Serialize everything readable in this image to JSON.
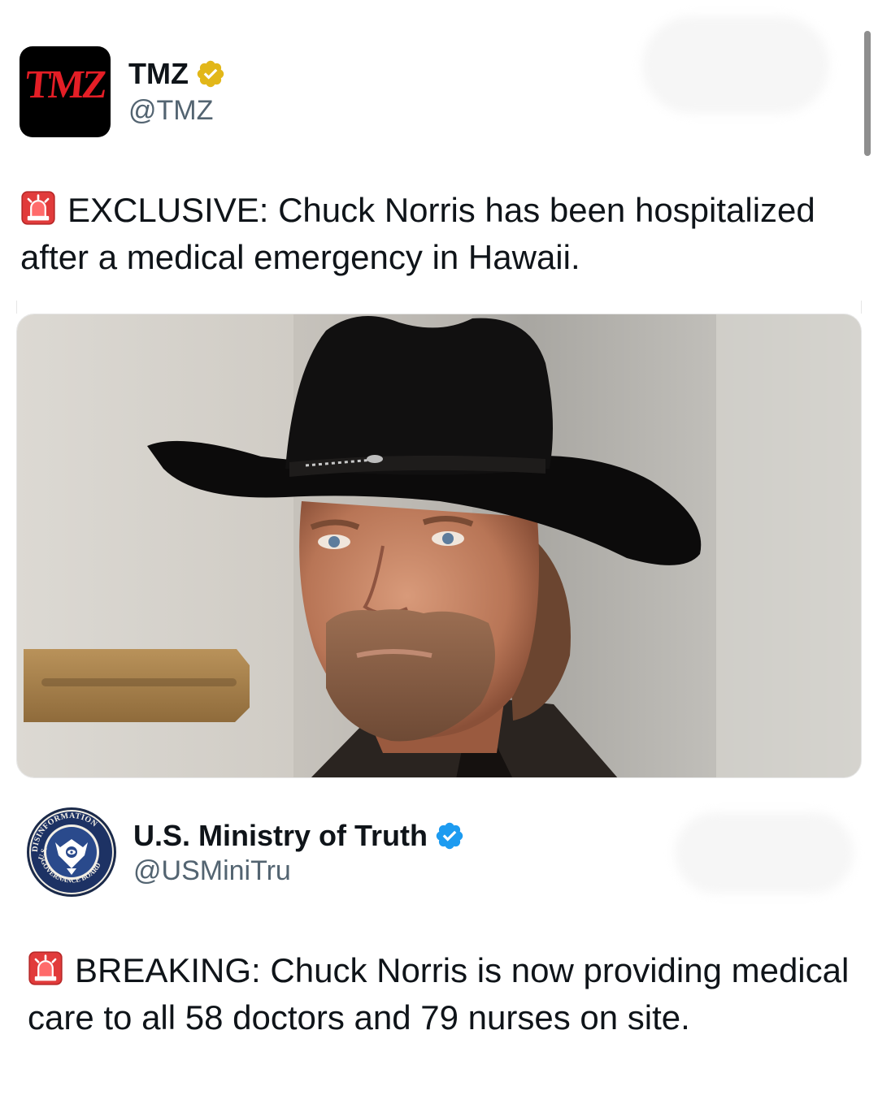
{
  "tweets": [
    {
      "display_name": "TMZ",
      "handle": "@TMZ",
      "verified": "gold",
      "avatar_logo": "TMZ",
      "text": "EXCLUSIVE: Chuck Norris has been hospitalized after a medical emergency in Hawaii.",
      "text_icon": "rotating-light-icon",
      "media": {
        "subject": "man-in-black-cowboy-hat-photo"
      }
    },
    {
      "display_name": "U.S. Ministry of Truth",
      "handle": "@USMiniTru",
      "verified": "blue",
      "avatar_seal_top": "DISINFORMATION",
      "avatar_seal_left": "U.S.",
      "avatar_seal_bottom": "GOVERNANCE BOARD",
      "text": "BREAKING: Chuck Norris is now providing medical care to all 58 doctors and 79 nurses on site.",
      "text_icon": "rotating-light-icon"
    }
  ],
  "colors": {
    "text_primary": "#0f1419",
    "text_secondary": "#536471",
    "verified_gold": "#e2b719",
    "verified_blue": "#1d9bf0",
    "tmz_red": "#e41e26"
  }
}
